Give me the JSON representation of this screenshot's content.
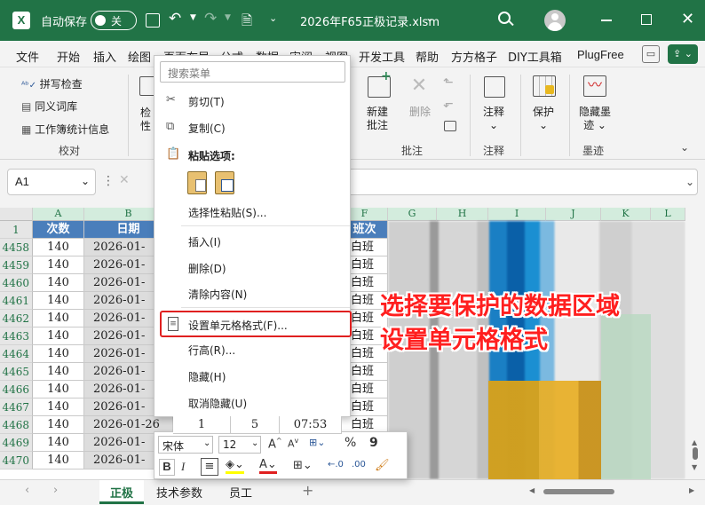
{
  "titlebar": {
    "autosave_label": "自动保存",
    "autosave_state": "关",
    "filename": "2026年F65正极记录.xlsm"
  },
  "ribbon_tabs": [
    "文件",
    "开始",
    "插入",
    "绘图",
    "页面布局",
    "公式",
    "数据",
    "审阅",
    "视图",
    "开发工具",
    "帮助",
    "方方格子",
    "DIY工具箱",
    "PlugFree"
  ],
  "ribbon": {
    "proofing_items": [
      "拼写检查",
      "同义词库",
      "工作簿统计信息"
    ],
    "proofing_group": "校对",
    "comments_new_line1": "新建",
    "comments_new_line2": "批注",
    "comments_delete": "删除",
    "comments_group": "批注",
    "notes_label": "注释",
    "notes_group": "注释",
    "protect_label": "保护",
    "ink_label_line1": "隐藏墨",
    "ink_label_line2": "迹",
    "ink_group": "墨迹",
    "partial_left_1": "检",
    "partial_left_2": "性"
  },
  "formula_bar": {
    "name_box": "A1"
  },
  "columns": [
    "A",
    "B",
    "F",
    "G",
    "H",
    "I",
    "J",
    "K",
    "L"
  ],
  "header_row": {
    "row": "1",
    "a": "次数",
    "b": "日期",
    "f": "班次"
  },
  "rows": [
    {
      "row": "4458",
      "a": "140",
      "b": "2026-01-",
      "f": "白班"
    },
    {
      "row": "4459",
      "a": "140",
      "b": "2026-01-",
      "f": "白班"
    },
    {
      "row": "4460",
      "a": "140",
      "b": "2026-01-",
      "f": "白班"
    },
    {
      "row": "4461",
      "a": "140",
      "b": "2026-01-",
      "f": "白班"
    },
    {
      "row": "4462",
      "a": "140",
      "b": "2026-01-",
      "f": "白班"
    },
    {
      "row": "4463",
      "a": "140",
      "b": "2026-01-",
      "f": "白班"
    },
    {
      "row": "4464",
      "a": "140",
      "b": "2026-01-",
      "f": "白班"
    },
    {
      "row": "4465",
      "a": "140",
      "b": "2026-01-",
      "f": "白班"
    },
    {
      "row": "4466",
      "a": "140",
      "b": "2026-01-",
      "f": "白班"
    },
    {
      "row": "4467",
      "a": "140",
      "b": "2026-01-",
      "f": "白班"
    },
    {
      "row": "4468",
      "a": "140",
      "b": "2026-01-26",
      "c": "1",
      "d": "5",
      "e": "07:53",
      "f": "白班"
    },
    {
      "row": "4469",
      "a": "140",
      "b": "2026-01-",
      "f": "白班"
    },
    {
      "row": "4470",
      "a": "140",
      "b": "2026-01-",
      "f": "白班"
    }
  ],
  "context_menu": {
    "search_placeholder": "搜索菜单",
    "cut": "剪切(T)",
    "copy": "复制(C)",
    "paste_options": "粘贴选项:",
    "paste_special": "选择性粘贴(S)...",
    "insert": "插入(I)",
    "delete": "删除(D)",
    "clear": "清除内容(N)",
    "format_cells": "设置单元格格式(F)...",
    "row_height": "行高(R)...",
    "hide": "隐藏(H)",
    "unhide": "取消隐藏(U)"
  },
  "mini_toolbar": {
    "font": "宋体",
    "size": "12",
    "bold": "B",
    "italic": "I",
    "percent": "%",
    "comma": "9"
  },
  "annotation": {
    "line1": "选择要保护的数据区域",
    "line2": "设置单元格格式"
  },
  "sheet_tabs": [
    "正极",
    "技术参数",
    "员工"
  ],
  "colors": {
    "excel_green": "#217346",
    "header_blue": "#4a7ebb",
    "annotation_red": "#ff1f1f",
    "arrow_purple": "#a020f0",
    "highlight_border": "#e02020"
  }
}
